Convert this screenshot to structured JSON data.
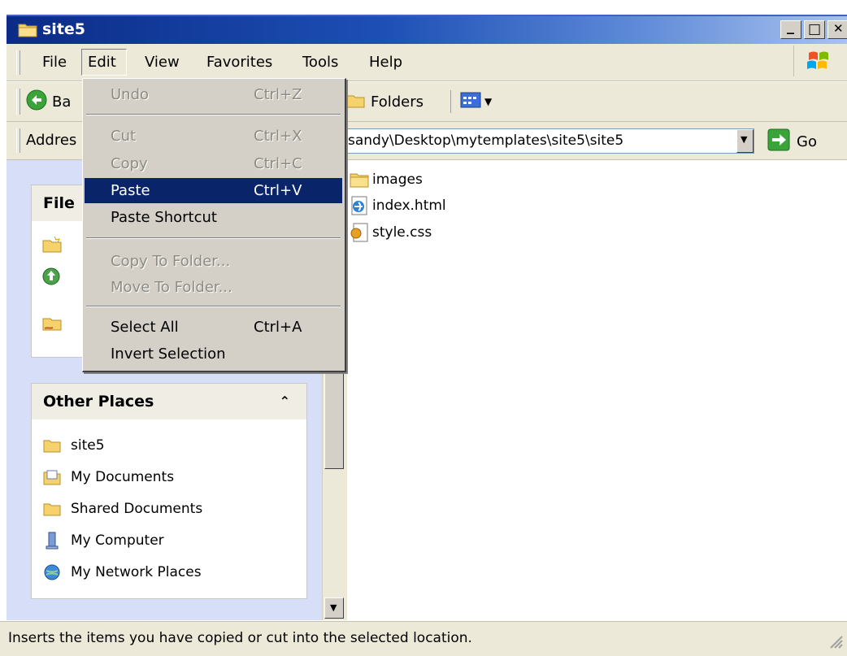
{
  "window": {
    "title": "site5",
    "min_glyph": "_",
    "max_glyph": "□",
    "close_glyph": "✕"
  },
  "menubar": {
    "items": [
      "File",
      "Edit",
      "View",
      "Favorites",
      "Tools",
      "Help"
    ]
  },
  "toolbar": {
    "back_label": "Ba",
    "folders_label": "Folders"
  },
  "address": {
    "label": "Addres",
    "value": "sandy\\Desktop\\mytemplates\\site5\\site5",
    "go_label": "Go"
  },
  "task_pane": {
    "file_tasks_title": "File",
    "other_places_title": "Other Places",
    "collapse_glyph": "⌃",
    "other_places": [
      "site5",
      "My Documents",
      "Shared Documents",
      "My Computer",
      "My Network Places"
    ]
  },
  "files": [
    "images",
    "index.html",
    "style.css"
  ],
  "edit_menu": {
    "items": [
      {
        "label": "Undo",
        "shortcut": "Ctrl+Z",
        "state": "disabled"
      },
      {
        "label": "Cut",
        "shortcut": "Ctrl+X",
        "state": "disabled"
      },
      {
        "label": "Copy",
        "shortcut": "Ctrl+C",
        "state": "disabled"
      },
      {
        "label": "Paste",
        "shortcut": "Ctrl+V",
        "state": "highlighted"
      },
      {
        "label": "Paste Shortcut",
        "shortcut": "",
        "state": "enabled"
      },
      {
        "label": "Copy To Folder...",
        "shortcut": "",
        "state": "disabled"
      },
      {
        "label": "Move To Folder...",
        "shortcut": "",
        "state": "disabled"
      },
      {
        "label": "Select All",
        "shortcut": "Ctrl+A",
        "state": "enabled"
      },
      {
        "label": "Invert Selection",
        "shortcut": "",
        "state": "enabled"
      }
    ]
  },
  "status": {
    "text": "Inserts the items you have copied or cut into the selected location."
  },
  "colors": {
    "title_bar": "#0b2b86",
    "menu_highlight": "#0a246a",
    "task_pane_bg": "#d6dff7",
    "chrome": "#ece9d8"
  }
}
